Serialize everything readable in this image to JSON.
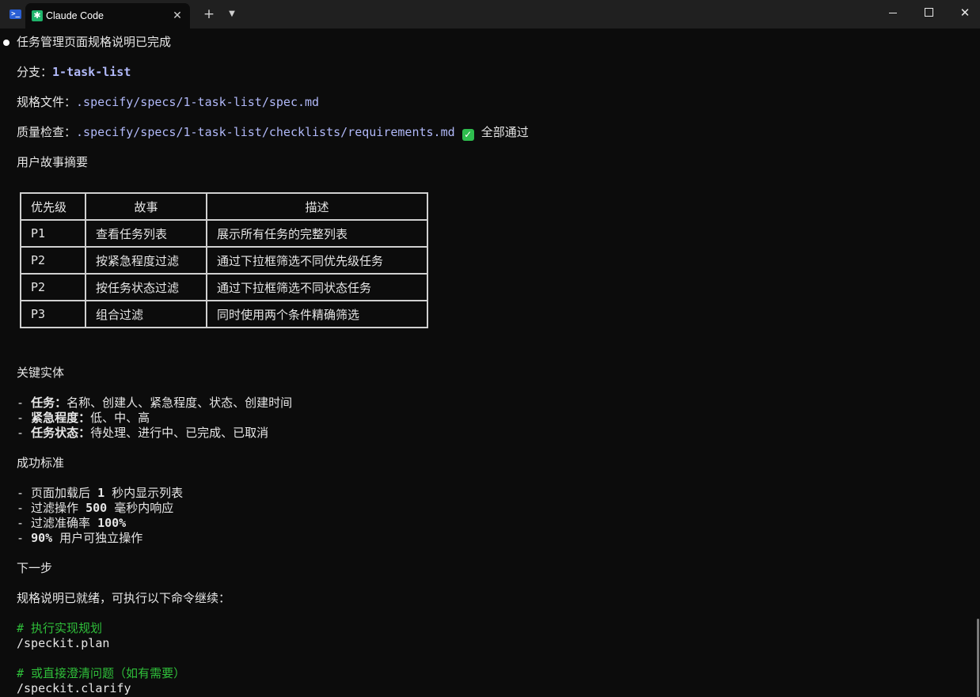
{
  "titlebar": {
    "tab_title": "Claude Code",
    "close_glyph": "✕",
    "new_tab_glyph": "+",
    "dropdown_glyph": "⌄",
    "close_window_glyph": "✕"
  },
  "terminal": {
    "heading": "任务管理页面规格说明已完成",
    "branch_label": "分支：",
    "branch_value": "1-task-list",
    "spec_label": "规格文件：",
    "spec_value": ".specify/specs/1-task-list/spec.md",
    "qa_label": "质量检查：",
    "qa_value": ".specify/specs/1-task-list/checklists/requirements.md",
    "qa_status": "全部通过",
    "stories_title": "用户故事摘要",
    "table": {
      "headers": [
        "优先级",
        "故事",
        "描述"
      ],
      "rows": [
        [
          "P1",
          "查看任务列表",
          "展示所有任务的完整列表"
        ],
        [
          "P2",
          "按紧急程度过滤",
          "通过下拉框筛选不同优先级任务"
        ],
        [
          "P2",
          "按任务状态过滤",
          "通过下拉框筛选不同状态任务"
        ],
        [
          "P3",
          "组合过滤",
          "同时使用两个条件精确筛选"
        ]
      ]
    },
    "entities_title": "关键实体",
    "entities": [
      {
        "prefix": "- ",
        "name": "任务：",
        "desc": "名称、创建人、紧急程度、状态、创建时间"
      },
      {
        "prefix": "- ",
        "name": "紧急程度：",
        "desc": "低、中、高"
      },
      {
        "prefix": "- ",
        "name": "任务状态：",
        "desc": "待处理、进行中、已完成、已取消"
      }
    ],
    "criteria_title": "成功标准",
    "criteria": [
      {
        "a": "- 页面加载后 ",
        "b": "1",
        "c": " 秒内显示列表"
      },
      {
        "a": "- 过滤操作 ",
        "b": "500",
        "c": " 毫秒内响应"
      },
      {
        "a": "- 过滤准确率 ",
        "b": "100%",
        "c": ""
      },
      {
        "a": "- ",
        "b": "90%",
        "c": " 用户可独立操作"
      }
    ],
    "next_title": "下一步",
    "next_desc": "规格说明已就绪，可执行以下命令继续：",
    "cmd1_comment": "# 执行实现规划",
    "cmd1": "/speckit.plan",
    "cmd2_comment": "# 或直接澄清问题（如有需要）",
    "cmd2": "/speckit.clarify"
  },
  "colors": {
    "background": "#0c0c0c",
    "titlebar": "#202020",
    "path": "#b1b9f9",
    "comment": "#2fbf3a",
    "check": "#2ebd4e"
  }
}
